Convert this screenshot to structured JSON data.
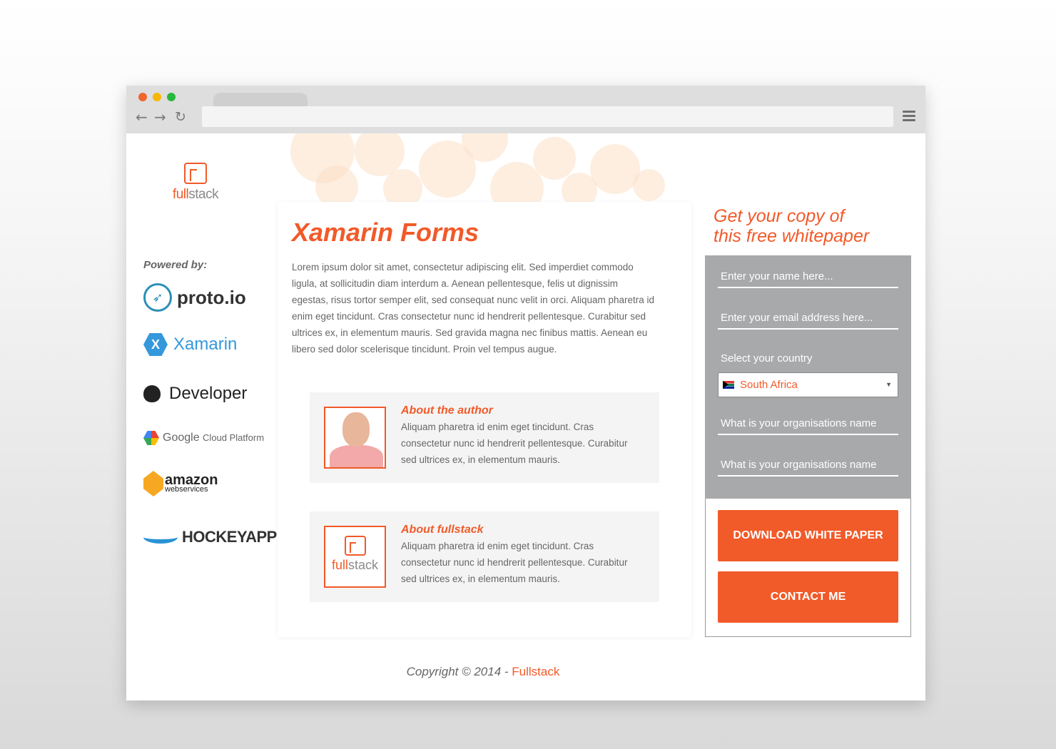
{
  "browser": {
    "back_icon": "arrow-left-icon",
    "forward_icon": "arrow-right-icon",
    "reload_icon": "reload-icon",
    "menu_icon": "hamburger-icon",
    "window_dots": [
      "#f0652b",
      "#f5b700",
      "#28b93c"
    ]
  },
  "logo": {
    "part1": "full",
    "part2": "stack"
  },
  "sidebar": {
    "powered_by": "Powered by:",
    "sponsors": {
      "proto": "proto.io",
      "xamarin": "Xamarin",
      "developer": "Developer",
      "google_main": "Google",
      "google_sub": "Cloud Platform",
      "aws_main": "amazon",
      "aws_sub": "webservices",
      "hockey": "HOCKEYAPP"
    }
  },
  "main": {
    "title": "Xamarin Forms",
    "body": "Lorem ipsum dolor sit amet, consectetur adipiscing elit. Sed imperdiet commodo ligula, at sollicitudin diam interdum a. Aenean pellentesque, felis ut dignissim egestas, risus tortor semper elit, sed consequat nunc velit in orci. Aliquam pharetra id enim eget tincidunt. Cras consectetur nunc id hendrerit pellentesque. Curabitur sed ultrices ex, in elementum mauris. Sed gravida magna nec finibus mattis. Aenean eu libero sed dolor scelerisque tincidunt. Proin vel tempus augue.",
    "author": {
      "title": "About the author",
      "text": "Aliquam pharetra id enim eget tincidunt. Cras consectetur nunc id hendrerit pellentesque. Curabitur sed ultrices ex, in elementum mauris."
    },
    "company": {
      "title": "About fullstack",
      "text": "Aliquam pharetra id enim eget tincidunt. Cras consectetur nunc id hendrerit pellentesque. Curabitur sed ultrices ex, in elementum mauris."
    }
  },
  "form": {
    "heading_line1": "Get your copy of",
    "heading_line2": "this free whitepaper",
    "name_placeholder": "Enter your name here...",
    "email_placeholder": "Enter your email address here...",
    "country_label": "Select your country",
    "country_value": "South Africa",
    "org_placeholder_1": "What is your organisations name",
    "org_placeholder_2": "What is your organisations name",
    "download_label": "DOWNLOAD WHITE PAPER",
    "contact_label": "CONTACT ME"
  },
  "footer": {
    "text": "Copyright © 2014 - ",
    "link": "Fullstack"
  },
  "colors": {
    "accent": "#f15a29",
    "form_bg": "#a7a9ab",
    "chrome": "#dedede"
  }
}
